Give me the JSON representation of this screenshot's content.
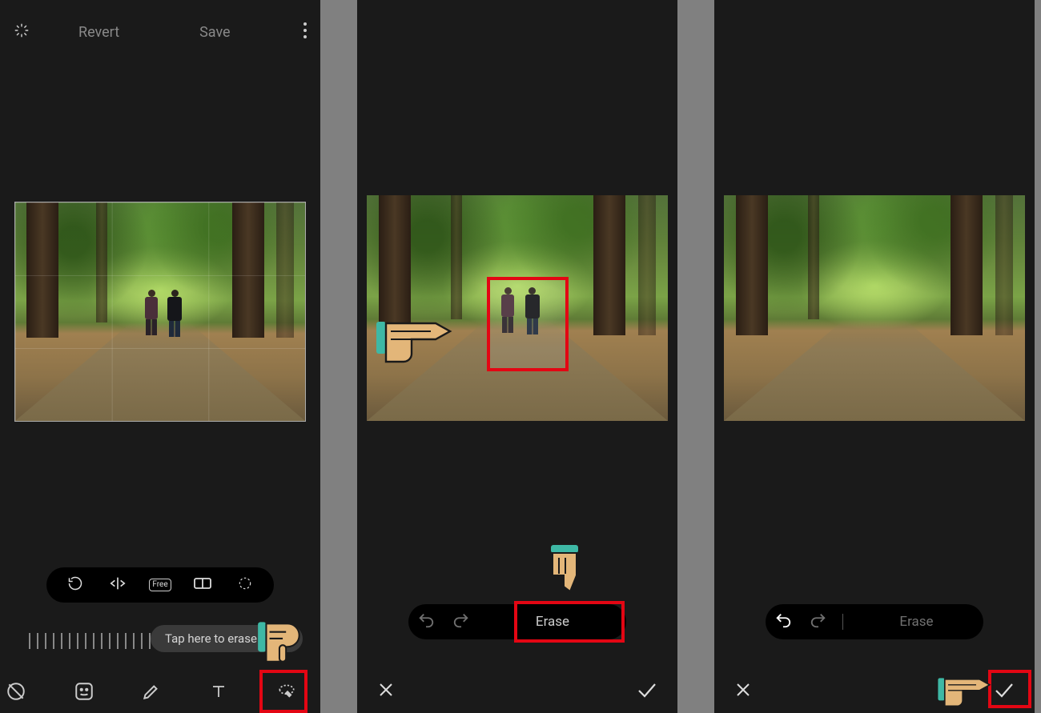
{
  "panel1": {
    "revert_label": "Revert",
    "save_label": "Save",
    "tooltip_text": "Tap here to erase objec",
    "crop_free_label": "Free"
  },
  "panel2": {
    "erase_label": "Erase"
  },
  "panel3": {
    "erase_label": "Erase"
  },
  "colors": {
    "highlight": "#e30613",
    "hand_skin": "#e3b679",
    "hand_cuff": "#3eb8a5"
  }
}
